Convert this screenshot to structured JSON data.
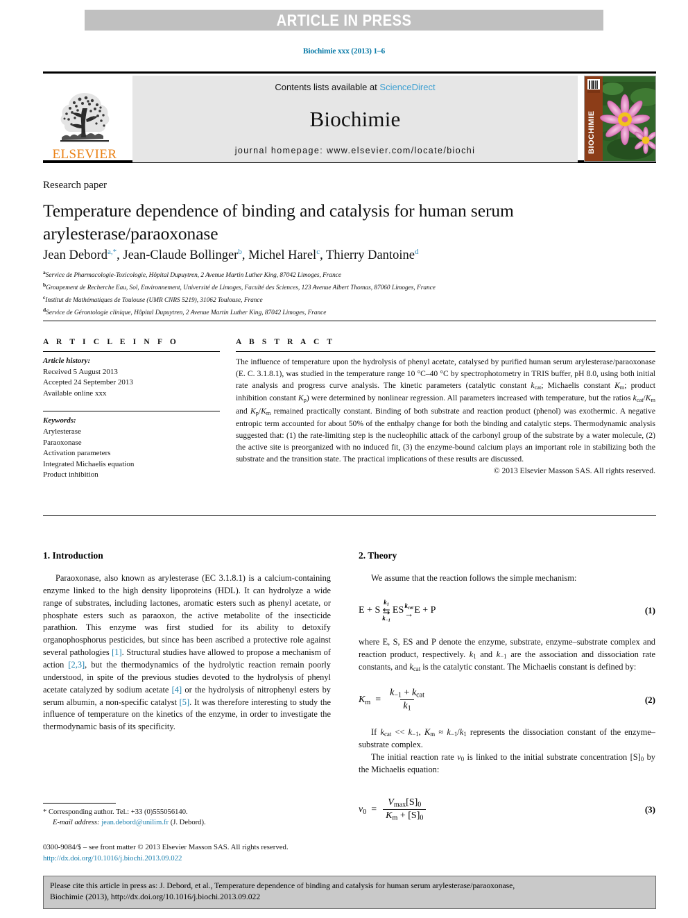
{
  "banner": {
    "text": "ARTICLE IN PRESS",
    "bg_color": "#c0c0c0",
    "text_color": "#ffffff"
  },
  "journal_ref": "Biochimie xxx (2013) 1–6",
  "masthead": {
    "publisher": "ELSEVIER",
    "contents_prefix": "Contents lists available at ",
    "contents_link": "ScienceDirect",
    "journal_name": "Biochimie",
    "homepage": "journal homepage: www.elsevier.com/locate/biochi",
    "cover_label": "BIOCHIMIE",
    "link_color": "#3c9fd1",
    "publisher_color": "#ea8114"
  },
  "article": {
    "type_label": "Research paper",
    "title": "Temperature dependence of binding and catalysis for human serum arylesterase/paraoxonase",
    "authors": [
      {
        "name": "Jean Debord",
        "marks": "a,*"
      },
      {
        "name": "Jean-Claude Bollinger",
        "marks": "b"
      },
      {
        "name": "Michel Harel",
        "marks": "c"
      },
      {
        "name": "Thierry Dantoine",
        "marks": "d"
      }
    ],
    "affiliations": [
      {
        "mark": "a",
        "text": "Service de Pharmacologie-Toxicologie, Hôpital Dupuytren, 2 Avenue Martin Luther King, 87042 Limoges, France"
      },
      {
        "mark": "b",
        "text": "Groupement de Recherche Eau, Sol, Environnement, Université de Limoges, Faculté des Sciences, 123 Avenue Albert Thomas, 87060 Limoges, France"
      },
      {
        "mark": "c",
        "text": "Institut de Mathématiques de Toulouse (UMR CNRS 5219), 31062 Toulouse, France"
      },
      {
        "mark": "d",
        "text": "Service de Gérontologie clinique, Hôpital Dupuytren, 2 Avenue Martin Luther King, 87042 Limoges, France"
      }
    ]
  },
  "article_info": {
    "heading": "A R T I C L E  I N F O",
    "history_label": "Article history:",
    "history": [
      "Received 5 August 2013",
      "Accepted 24 September 2013",
      "Available online xxx"
    ],
    "keywords_label": "Keywords:",
    "keywords": [
      "Arylesterase",
      "Paraoxonase",
      "Activation parameters",
      "Integrated Michaelis equation",
      "Product inhibition"
    ]
  },
  "abstract": {
    "heading": "A B S T R A C T",
    "copyright": "© 2013 Elsevier Masson SAS. All rights reserved."
  },
  "sections": {
    "intro_heading": "1.  Introduction",
    "theory_heading": "2.  Theory",
    "theory_lead": "We assume that the reaction follows the simple mechanism:",
    "eq1_number": "(1)",
    "eq2_number": "(2)",
    "eq3_number": "(3)"
  },
  "footnotes": {
    "corresponding": "* Corresponding author. Tel.: +33 (0)555056140.",
    "email_label": "E-mail address:",
    "email": "jean.debord@unilim.fr",
    "email_suffix": "(J. Debord).",
    "issn": "0300-9084/$ – see front matter © 2013 Elsevier Masson SAS. All rights reserved.",
    "doi": "http://dx.doi.org/10.1016/j.biochi.2013.09.022"
  },
  "citation_box": {
    "line1": "Please cite this article in press as: J. Debord, et al., Temperature dependence of binding and catalysis for human serum arylesterase/paraoxonase,",
    "line2": "Biochimie (2013), http://dx.doi.org/10.1016/j.biochi.2013.09.022"
  },
  "equations": {
    "eq1": {
      "left": "E + S",
      "k_fwd": "k₁",
      "k_rev": "k₋₁",
      "k_cat": "k",
      "mid": "ES",
      "right": "E + P"
    },
    "eq2": {
      "lhs": "K",
      "num": "k₋₁ + k",
      "den": "k₁"
    },
    "eq3": {
      "lhs": "v₀",
      "num": "V",
      "den": "K"
    }
  }
}
